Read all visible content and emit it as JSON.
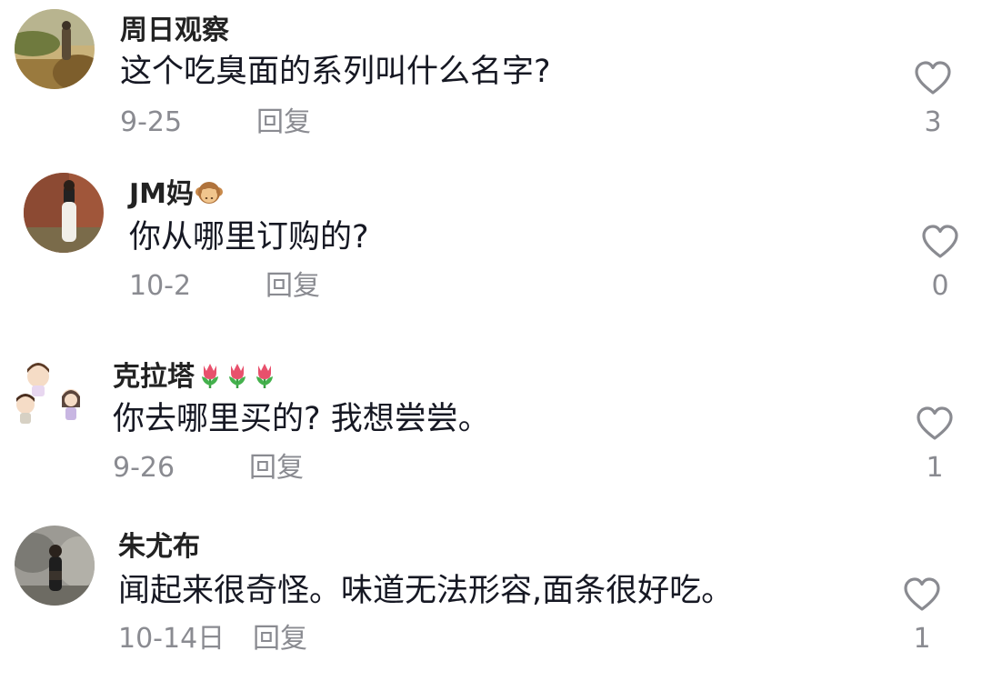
{
  "comments": [
    {
      "username": "周日观察",
      "text": "这个吃臭面的系列叫什么名字?",
      "date": "9-25",
      "reply_label": "回复",
      "likes": "3"
    },
    {
      "username": "JM妈",
      "username_emoji": "monkey-face-icon",
      "text": "你从哪里订购的?",
      "date": "10-2",
      "reply_label": "回复",
      "likes": "0"
    },
    {
      "username": "克拉塔",
      "username_emoji": "tulip-icon x3",
      "text": "你去哪里买的? 我想尝尝。",
      "date": "9-26",
      "reply_label": "回复",
      "likes": "1"
    },
    {
      "username": "朱尤布",
      "text": "闻起来很奇怪。味道无法形容,面条很好吃。",
      "date": "10-14日",
      "reply_label": "回复",
      "likes": "1"
    }
  ],
  "colors": {
    "username": "#222222",
    "text": "#161823",
    "meta": "#8a8b91",
    "heart": "#8a8b91"
  }
}
